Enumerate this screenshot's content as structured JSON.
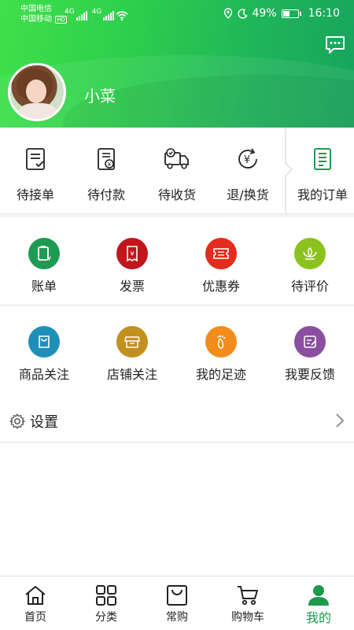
{
  "status_bar": {
    "carrier1": "中国电信",
    "carrier2": "中国移动",
    "network1": "4G",
    "network2": "4G",
    "hd_badge": "HD",
    "battery": "49%",
    "battery_level": 0.49,
    "time": "16:10"
  },
  "profile": {
    "username": "小菜"
  },
  "orders": [
    {
      "label": "待接单",
      "icon": "clipboard-check-icon"
    },
    {
      "label": "待付款",
      "icon": "yen-document-icon"
    },
    {
      "label": "待收货",
      "icon": "delivery-truck-icon"
    },
    {
      "label": "退/换货",
      "icon": "yen-refresh-icon"
    },
    {
      "label": "我的订单",
      "icon": "order-list-icon"
    }
  ],
  "grid_row1": [
    {
      "label": "账单",
      "icon": "bill-icon",
      "color": "#1e9a52"
    },
    {
      "label": "发票",
      "icon": "invoice-icon",
      "color": "#c0161c"
    },
    {
      "label": "优惠券",
      "icon": "coupon-icon",
      "color": "#e52a1e"
    },
    {
      "label": "待评价",
      "icon": "lotus-icon",
      "color": "#8cc220"
    }
  ],
  "grid_row2": [
    {
      "label": "商品关注",
      "icon": "bag-icon",
      "color": "#1e8fb8"
    },
    {
      "label": "店铺关注",
      "icon": "store-icon",
      "color": "#c2901e"
    },
    {
      "label": "我的足迹",
      "icon": "footprint-icon",
      "color": "#f28c1a"
    },
    {
      "label": "我要反馈",
      "icon": "feedback-icon",
      "color": "#8a4fa0"
    }
  ],
  "settings": {
    "label": "设置"
  },
  "bottom_nav": [
    {
      "label": "首页",
      "icon": "home-icon"
    },
    {
      "label": "分类",
      "icon": "category-grid-icon"
    },
    {
      "label": "常购",
      "icon": "shopping-bag-icon"
    },
    {
      "label": "购物车",
      "icon": "cart-icon"
    },
    {
      "label": "我的",
      "icon": "user-icon",
      "active": true
    }
  ],
  "colors": {
    "brand_green": "#2ecf4c",
    "active_nav": "#1a9a4c"
  }
}
